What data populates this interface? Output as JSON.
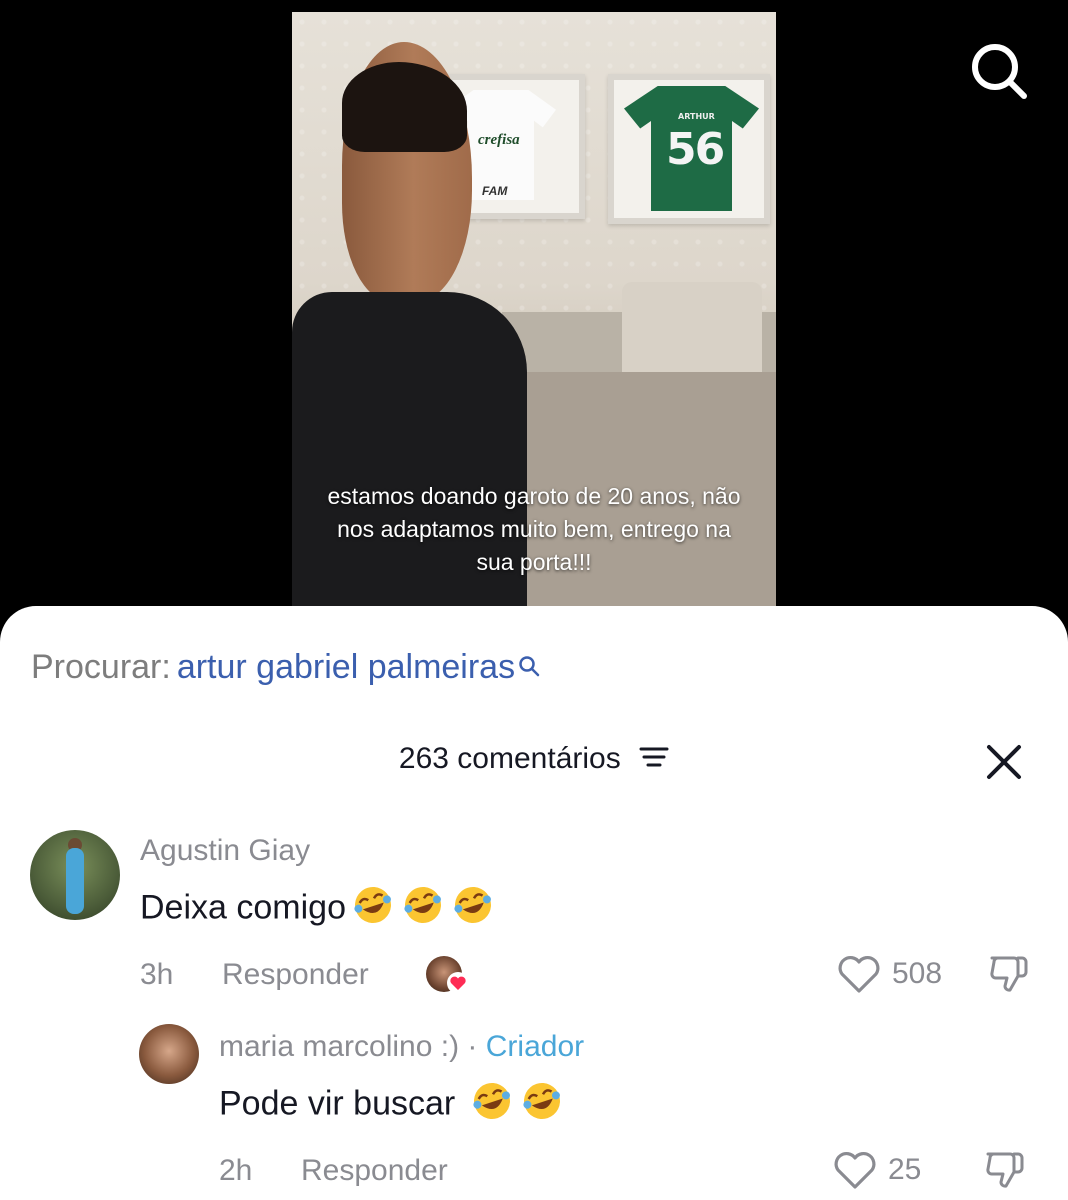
{
  "video": {
    "caption": "estamos doando garoto de 20 anos, não nos adaptamos muito bem, entrego na sua porta!!!",
    "jersey_sponsor": "crefisa",
    "jersey_sponsor_2": "FAM",
    "jersey_name": "ARTHUR",
    "jersey_number": "56"
  },
  "search": {
    "prefix": "Procurar:",
    "term": "artur gabriel palmeiras"
  },
  "comments_header": {
    "title": "263 comentários"
  },
  "comments": [
    {
      "username": "Agustin Giay",
      "text": "Deixa comigo",
      "emojis": [
        "rolling-laughing-emoji",
        "rolling-laughing-emoji",
        "rolling-laughing-emoji"
      ],
      "time": "3h",
      "reply_label": "Responder",
      "likes": "508",
      "liked_by_creator": true
    },
    {
      "username": "maria marcolino :)",
      "separator": "·",
      "badge": "Criador",
      "text": "Pode vir buscar",
      "emojis": [
        "rolling-laughing-emoji",
        "rolling-laughing-emoji"
      ],
      "time": "2h",
      "reply_label": "Responder",
      "likes": "25"
    }
  ],
  "colors": {
    "link_blue": "#3b5fae",
    "creator_blue": "#4aa6d8",
    "muted_text": "#8a8b91",
    "heart_red": "#fe2c55"
  }
}
